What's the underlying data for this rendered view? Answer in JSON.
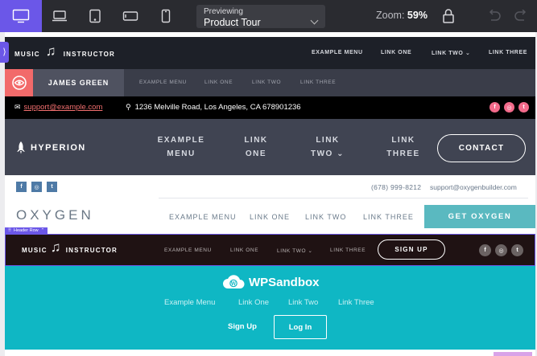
{
  "toolbar": {
    "devices": [
      {
        "name": "desktop",
        "active": true
      },
      {
        "name": "laptop",
        "active": false
      },
      {
        "name": "tablet-landscape",
        "active": false
      },
      {
        "name": "tablet-portrait",
        "active": false
      },
      {
        "name": "mobile",
        "active": false
      }
    ],
    "preview_label": "Previewing",
    "preview_value": "Product Tour",
    "zoom_label": "Zoom:",
    "zoom_value": "59%",
    "accent": "#6b57e8"
  },
  "headers": {
    "music": {
      "brand_left": "MUSIC",
      "brand_right": "INSTRUCTOR",
      "nav": [
        "EXAMPLE MENU",
        "LINK ONE",
        "LINK TWO ⌄",
        "LINK THREE"
      ]
    },
    "james": {
      "name": "JAMES GREEN",
      "nav": [
        "EXAMPLE MENU",
        "LINK ONE",
        "LINK TWO",
        "LINK THREE"
      ],
      "accent": "#f26a6a"
    },
    "topbar": {
      "email": "support@example.com",
      "address": "1236 Melville Road, Los Angeles, CA 678901236",
      "socials": [
        "f",
        "◎",
        "t"
      ]
    },
    "hyperion": {
      "brand": "HYPERION",
      "nav": [
        {
          "l1": "EXAMPLE",
          "l2": "MENU"
        },
        {
          "l1": "LINK",
          "l2": "ONE"
        },
        {
          "l1": "LINK",
          "l2": "TWO ⌄"
        },
        {
          "l1": "LINK",
          "l2": "THREE"
        }
      ],
      "cta": "CONTACT"
    },
    "oxygen": {
      "socials": [
        "f",
        "◎",
        "t"
      ],
      "phone": "(678) 999-8212",
      "email": "support@oxygenbuilder.com",
      "logo": "OXYGEN",
      "nav": [
        "EXAMPLE MENU",
        "LINK ONE",
        "LINK TWO",
        "LINK THREE"
      ],
      "cta": "GET OXYGEN",
      "accent": "#5ab9c0"
    },
    "music_dark": {
      "tag": "Header Row",
      "brand_left": "MUSIC",
      "brand_right": "INSTRUCTOR",
      "nav": [
        "EXAMPLE MENU",
        "LINK ONE",
        "LINK TWO ⌄",
        "LINK THREE"
      ],
      "cta": "SIGN UP",
      "socials": [
        "f",
        "◎",
        "t"
      ]
    },
    "wpsandbox": {
      "brand": "WPSandbox",
      "nav": [
        "Example Menu",
        "Link One",
        "Link Two",
        "Link Three"
      ],
      "signup": "Sign Up",
      "login": "Log In",
      "accent": "#0fb7c4"
    }
  }
}
